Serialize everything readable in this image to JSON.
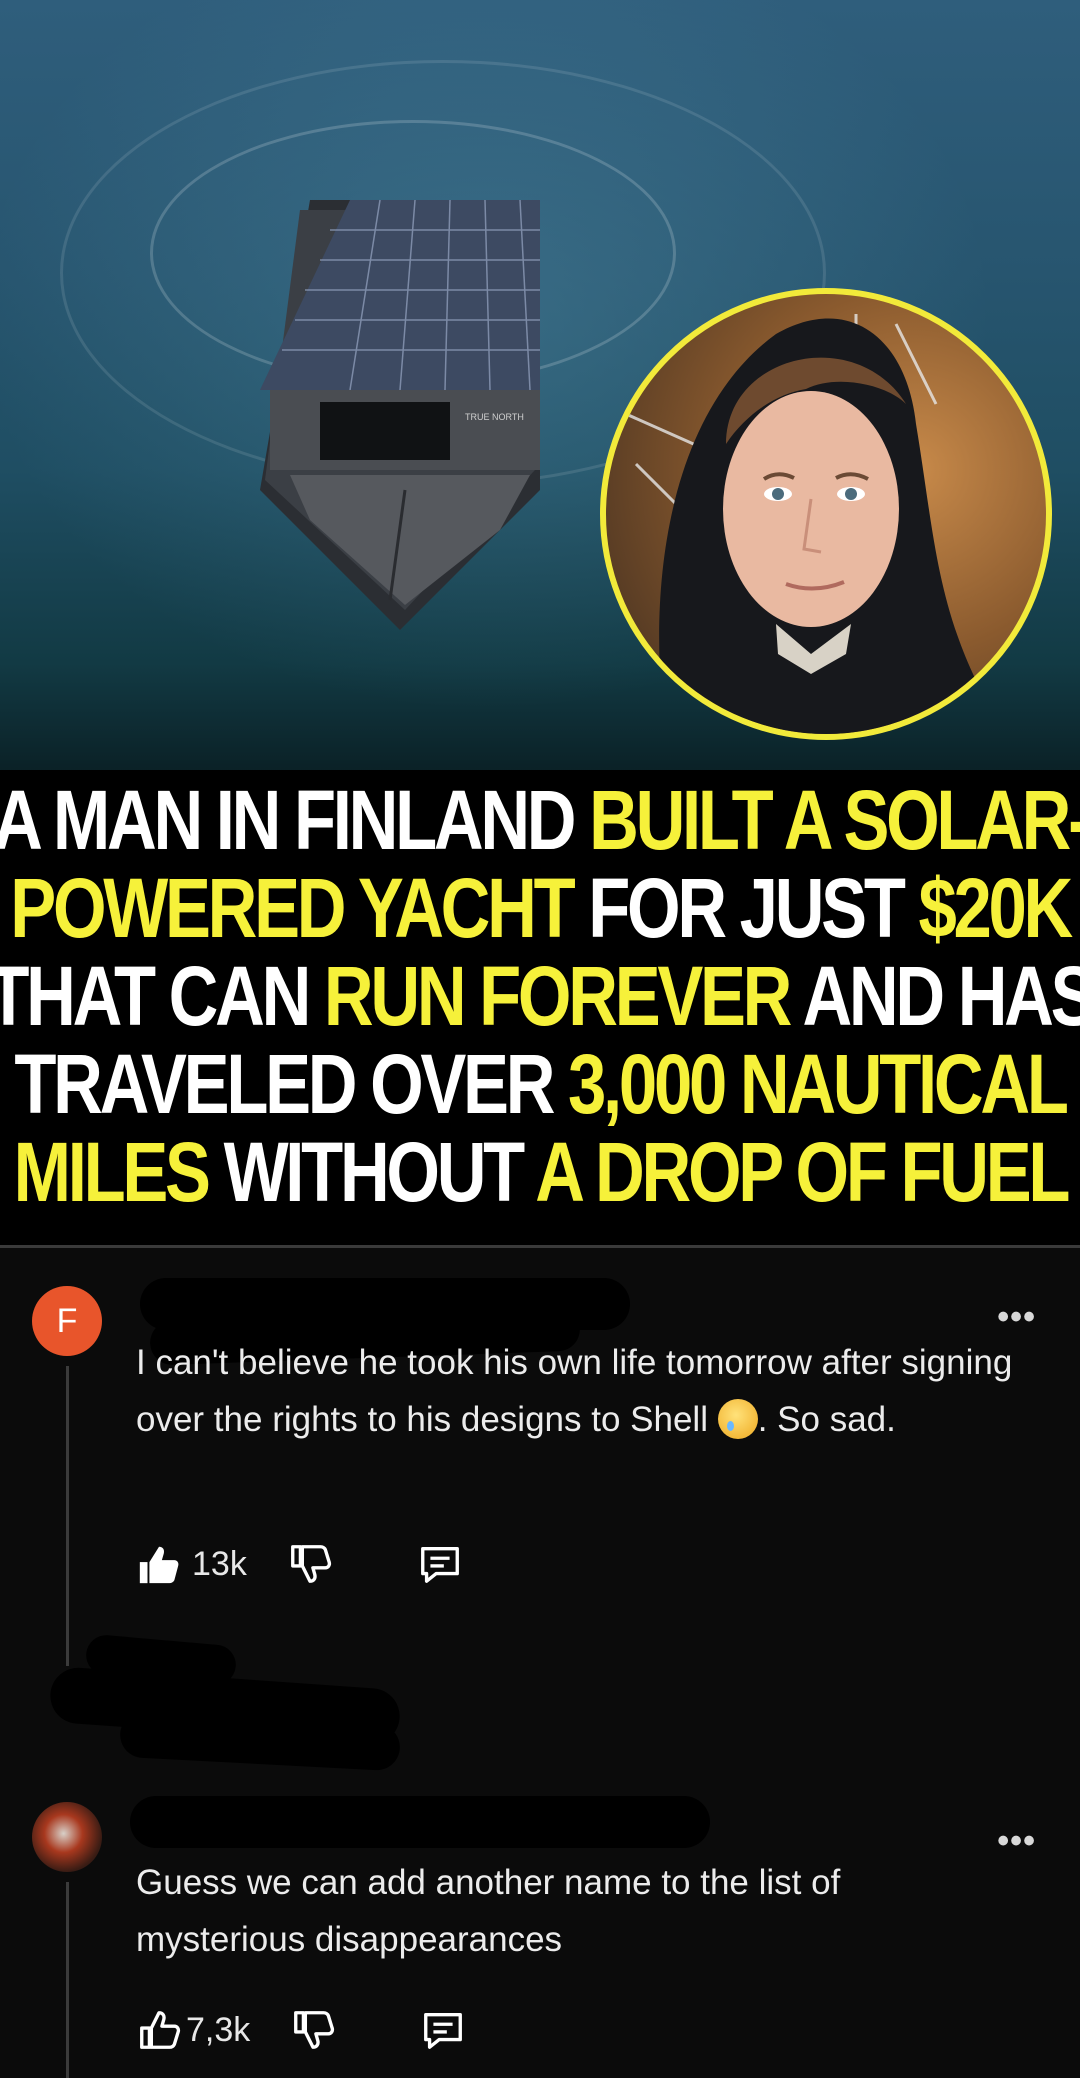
{
  "headline": {
    "lines": [
      [
        {
          "t": "A MAN IN FINLAND ",
          "c": "w"
        },
        {
          "t": "BUILT A SOLAR-",
          "c": "y"
        }
      ],
      [
        {
          "t": "POWERED YACHT ",
          "c": "y"
        },
        {
          "t": "FOR JUST ",
          "c": "w"
        },
        {
          "t": "$20K",
          "c": "y"
        }
      ],
      [
        {
          "t": "THAT CAN ",
          "c": "w"
        },
        {
          "t": "RUN FOREVER ",
          "c": "y"
        },
        {
          "t": "AND HAS",
          "c": "w"
        }
      ],
      [
        {
          "t": "TRAVELED OVER ",
          "c": "w"
        },
        {
          "t": "3,000 NAUTICAL",
          "c": "y"
        }
      ],
      [
        {
          "t": "MILES ",
          "c": "y"
        },
        {
          "t": "WITHOUT ",
          "c": "w"
        },
        {
          "t": "A DROP OF FUEL",
          "c": "y"
        }
      ]
    ]
  },
  "boat_sign": "TRUE NORTH",
  "comments": [
    {
      "avatar_letter": "F",
      "more": "•••",
      "text_1": "I can't believe he took his own life tomorrow after signing over the rights to his designs to Shell",
      "text_2": ". So sad.",
      "upvotes": "13k"
    },
    {
      "more": "•••",
      "text": "Guess we can add another name to the list of mysterious disappearances",
      "upvotes": "7,3k"
    }
  ],
  "icons": {
    "upvote_filled": "thumbs-up-filled-icon",
    "upvote_outline": "thumbs-up-outline-icon",
    "downvote": "thumbs-down-icon",
    "reply": "reply-comment-icon"
  },
  "colors": {
    "highlight_yellow": "#f6f13a",
    "avatar_orange": "#e8552b",
    "background": "#0b0b0b"
  }
}
